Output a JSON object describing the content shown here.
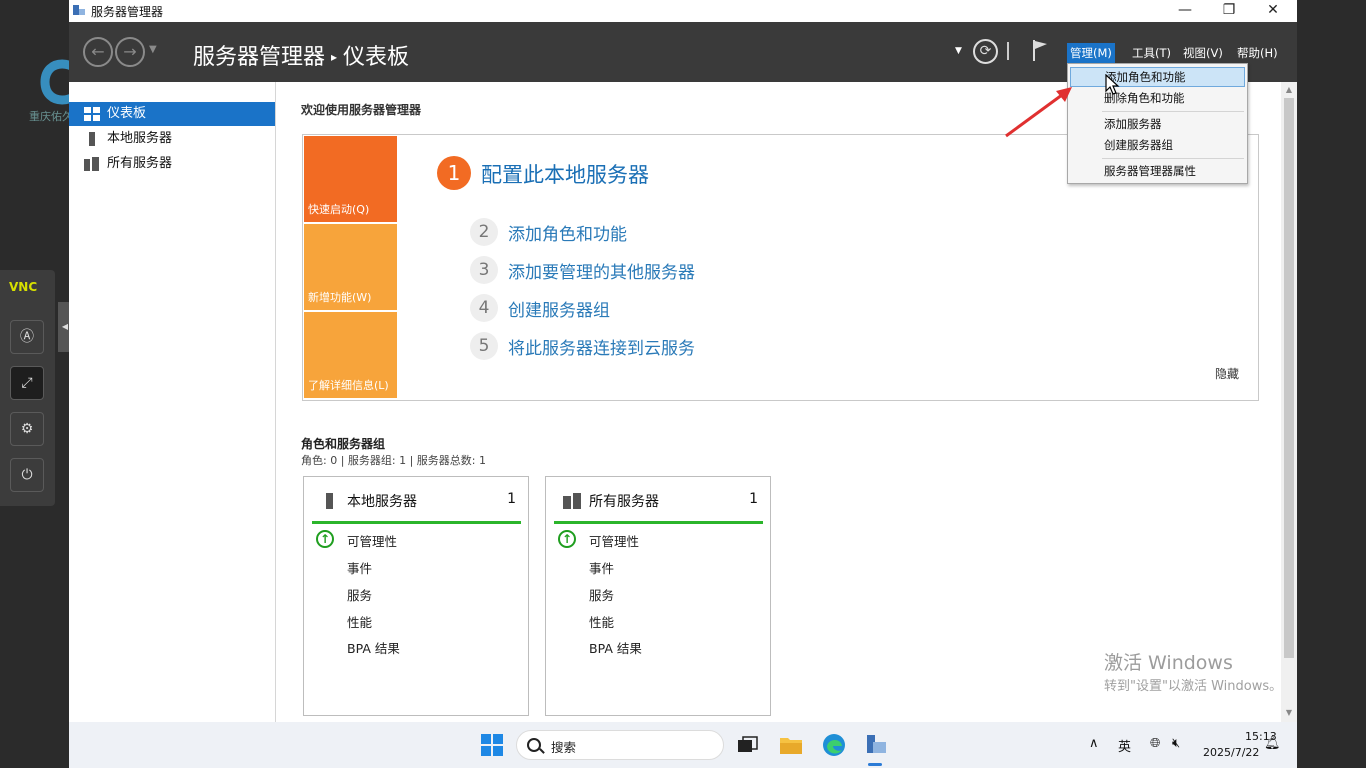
{
  "window": {
    "title": "服务器管理器",
    "controls": {
      "minimize": "—",
      "restore": "❐",
      "close": "✕"
    }
  },
  "header": {
    "breadcrumb_root": "服务器管理器",
    "breadcrumb_sep": "▸",
    "breadcrumb_current": "仪表板",
    "menus": [
      {
        "label": "管理(M)",
        "active": true
      },
      {
        "label": "工具(T)"
      },
      {
        "label": "视图(V)"
      },
      {
        "label": "帮助(H)"
      }
    ]
  },
  "sidebar": {
    "items": [
      {
        "label": "仪表板",
        "selected": true
      },
      {
        "label": "本地服务器"
      },
      {
        "label": "所有服务器"
      }
    ]
  },
  "main": {
    "welcome_title": "欢迎使用服务器管理器",
    "tiles": [
      "快速启动(Q)",
      "新增功能(W)",
      "了解详细信息(L)"
    ],
    "steps": [
      {
        "num": "1",
        "label": "配置此本地服务器"
      },
      {
        "num": "2",
        "label": "添加角色和功能"
      },
      {
        "num": "3",
        "label": "添加要管理的其他服务器"
      },
      {
        "num": "4",
        "label": "创建服务器组"
      },
      {
        "num": "5",
        "label": "将此服务器连接到云服务"
      }
    ],
    "hide_label": "隐藏",
    "roles_title": "角色和服务器组",
    "roles_summary": "角色: 0 | 服务器组: 1 | 服务器总数: 1",
    "cards": [
      {
        "title": "本地服务器",
        "count": "1",
        "items": [
          "可管理性",
          "事件",
          "服务",
          "性能",
          "BPA 结果"
        ]
      },
      {
        "title": "所有服务器",
        "count": "1",
        "items": [
          "可管理性",
          "事件",
          "服务",
          "性能",
          "BPA 结果"
        ]
      }
    ]
  },
  "dropdown": {
    "items": [
      "添加角色和功能",
      "删除角色和功能",
      "添加服务器",
      "创建服务器组",
      "服务器管理器属性"
    ],
    "highlighted_index": 0
  },
  "watermark": {
    "line1": "激活 Windows",
    "line2": "转到\"设置\"以激活 Windows。"
  },
  "taskbar": {
    "search_label": "搜索",
    "tray": {
      "chevron": "∧",
      "ime": "英"
    },
    "clock_time": "15:13",
    "clock_date": "2025/7/22"
  },
  "overlay": {
    "logo_text": "重庆佑久",
    "vnc_logo": "VNC"
  },
  "colors": {
    "accent": "#1a73c8",
    "tile_orange": "#f26b23",
    "tile_amber": "#f7a43b",
    "ok_green": "#2bb52b",
    "arrow_red": "#e03030"
  }
}
